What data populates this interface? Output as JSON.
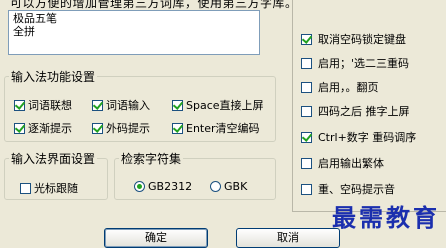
{
  "top_text": "可以方便的增加管理第三方词库，使用第三方字库。",
  "list_items": [
    "极品五笔",
    "全拼"
  ],
  "ime_functions": {
    "legend": "输入法功能设置",
    "options": [
      {
        "label": "词语联想",
        "checked": true
      },
      {
        "label": "词语输入",
        "checked": true
      },
      {
        "label": "Space直接上屏",
        "checked": true
      },
      {
        "label": "逐渐提示",
        "checked": true
      },
      {
        "label": "外码提示",
        "checked": true
      },
      {
        "label": "Enter清空编码",
        "checked": true
      }
    ]
  },
  "ime_interface": {
    "legend": "输入法界面设置",
    "options": [
      {
        "label": "光标跟随",
        "checked": false
      }
    ]
  },
  "charset": {
    "legend": "检索字符集",
    "options": [
      {
        "label": "GB2312",
        "checked": true
      },
      {
        "label": "GBK",
        "checked": false
      }
    ]
  },
  "right_options": [
    {
      "label": "取消空码锁定键盘",
      "checked": true
    },
    {
      "label": "启用；'选二三重码",
      "checked": false
    },
    {
      "label": "启用，。翻页",
      "checked": false
    },
    {
      "label": "四码之后 推字上屏",
      "checked": false
    },
    {
      "label": "Ctrl+数字 重码调序",
      "checked": true
    },
    {
      "label": "启用输出繁体",
      "checked": false
    },
    {
      "label": "重、空码提示音",
      "checked": false
    }
  ],
  "buttons": {
    "ok": "确定",
    "cancel": "取消"
  },
  "watermark": "最需教育"
}
